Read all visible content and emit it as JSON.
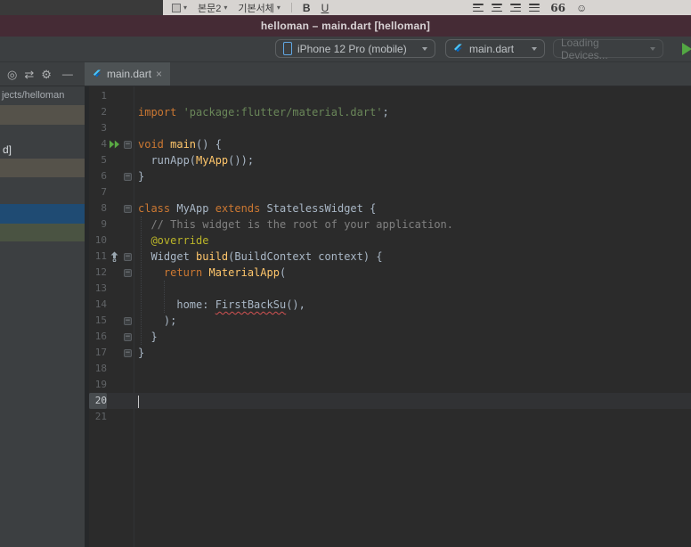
{
  "icons": {
    "chevron": "▾",
    "target": "◎",
    "swap": "⇄",
    "gear": "⚙",
    "collapse": "—",
    "emoji": "☺",
    "close": "×",
    "fold": "−"
  },
  "colors": {
    "run_green": "#53a843",
    "error_red": "#d25252",
    "keyword_orange": "#cc7832",
    "string_green": "#6a8759",
    "selection_blue": "#1f4b73",
    "titlebar_plum": "#452b35"
  },
  "overlay_toolbar": {
    "style_value": "본문2",
    "font_value": "기본서체",
    "bold_label": "B",
    "underline_label": "U",
    "quote_label": "66"
  },
  "title_bar": {
    "title": "helloman – main.dart [helloman]"
  },
  "run_toolbar": {
    "device_label": "iPhone 12 Pro (mobile)",
    "run_config_label": "main.dart",
    "devices_label": "Loading Devices..."
  },
  "tabs": {
    "active_label": "main.dart"
  },
  "project_panel": {
    "path_text": "jects/helloman",
    "item_text": "d]"
  },
  "editor": {
    "caret_line": 20,
    "fold_lines": [
      4,
      6,
      8,
      11,
      12,
      15,
      16,
      17
    ],
    "lines": [
      {
        "n": 1,
        "segs": []
      },
      {
        "n": 2,
        "segs": [
          [
            "kw",
            "import "
          ],
          [
            "str",
            "'package:flutter/material.dart'"
          ],
          [
            "pl",
            ";"
          ]
        ]
      },
      {
        "n": 3,
        "segs": []
      },
      {
        "n": 4,
        "gutter": "run",
        "segs": [
          [
            "kw",
            "void "
          ],
          [
            "fn",
            "main"
          ],
          [
            "pl",
            "() {"
          ]
        ]
      },
      {
        "n": 5,
        "segs": [
          [
            "pl",
            "  runApp("
          ],
          [
            "fn",
            "MyApp"
          ],
          [
            "pl",
            "());"
          ]
        ]
      },
      {
        "n": 6,
        "segs": [
          [
            "pl",
            "}"
          ]
        ]
      },
      {
        "n": 7,
        "segs": []
      },
      {
        "n": 8,
        "segs": [
          [
            "kw",
            "class "
          ],
          [
            "pl",
            "MyApp "
          ],
          [
            "kw",
            "extends "
          ],
          [
            "pl",
            "StatelessWidget {"
          ]
        ]
      },
      {
        "n": 9,
        "segs": [
          [
            "cm",
            "  // This widget is the root of your application."
          ]
        ]
      },
      {
        "n": 10,
        "segs": [
          [
            "pl",
            "  "
          ],
          [
            "an",
            "@override"
          ]
        ]
      },
      {
        "n": 11,
        "gutter": "override",
        "segs": [
          [
            "pl",
            "  Widget "
          ],
          [
            "fn",
            "build"
          ],
          [
            "pl",
            "(BuildContext context) {"
          ]
        ]
      },
      {
        "n": 12,
        "segs": [
          [
            "pl",
            "    "
          ],
          [
            "kw",
            "return "
          ],
          [
            "fn",
            "MaterialApp"
          ],
          [
            "pl",
            "("
          ]
        ]
      },
      {
        "n": 13,
        "segs": []
      },
      {
        "n": 14,
        "segs": [
          [
            "pl",
            "      home: "
          ],
          [
            "err",
            "FirstBackSu"
          ],
          [
            "pl",
            "(),"
          ]
        ]
      },
      {
        "n": 15,
        "segs": [
          [
            "pl",
            "    );"
          ]
        ]
      },
      {
        "n": 16,
        "segs": [
          [
            "pl",
            "  }"
          ]
        ]
      },
      {
        "n": 17,
        "segs": [
          [
            "pl",
            "}"
          ]
        ]
      },
      {
        "n": 18,
        "segs": []
      },
      {
        "n": 19,
        "segs": []
      },
      {
        "n": 20,
        "segs": []
      },
      {
        "n": 21,
        "segs": []
      }
    ]
  }
}
